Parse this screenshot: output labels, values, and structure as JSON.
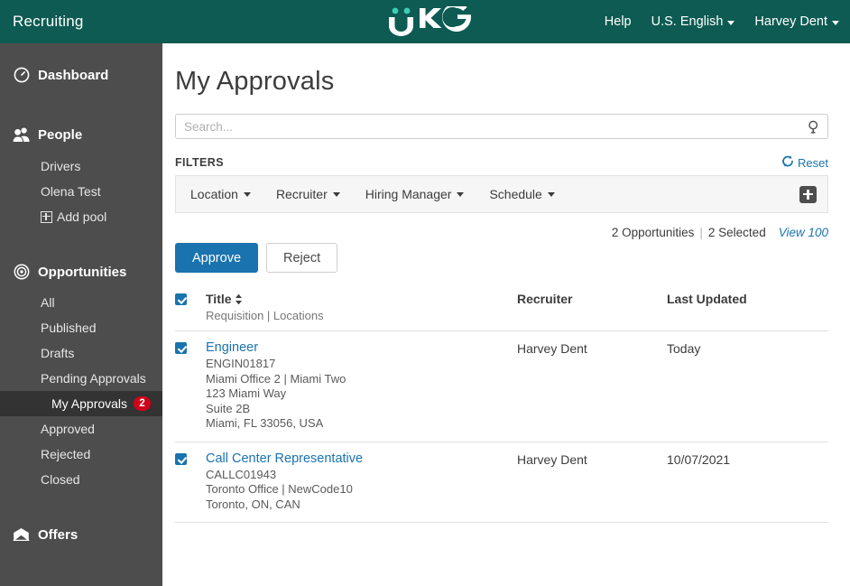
{
  "topbar": {
    "app_title": "Recruiting",
    "logo_text": "UKG",
    "logo_dot_color": "#3ccfb4",
    "nav": [
      {
        "label": "Help",
        "caret": false,
        "name": "help"
      },
      {
        "label": "U.S. English",
        "caret": true,
        "name": "language"
      },
      {
        "label": "Harvey Dent",
        "caret": true,
        "name": "user-menu"
      }
    ],
    "bg_color": "#0d5b53"
  },
  "sidebar": {
    "bg_color": "#4d4d4d",
    "active_bg_color": "#333333",
    "badge_color": "#d0021b",
    "groups": [
      {
        "name": "dashboard",
        "label": "Dashboard",
        "icon": "clock-icon",
        "items": []
      },
      {
        "name": "people",
        "label": "People",
        "icon": "people-icon",
        "items": [
          {
            "label": "Drivers",
            "name": "drivers",
            "active": false,
            "icon": null
          },
          {
            "label": "Olena Test",
            "name": "olena-test",
            "active": false,
            "icon": null
          },
          {
            "label": "Add pool",
            "name": "add-pool",
            "active": false,
            "icon": "square-plus-icon"
          }
        ]
      },
      {
        "name": "opportunities",
        "label": "Opportunities",
        "icon": "target-icon",
        "items": [
          {
            "label": "All",
            "name": "all",
            "active": false,
            "icon": null
          },
          {
            "label": "Published",
            "name": "published",
            "active": false,
            "icon": null
          },
          {
            "label": "Drafts",
            "name": "drafts",
            "active": false,
            "icon": null
          },
          {
            "label": "Pending Approvals",
            "name": "pending-approvals",
            "active": false,
            "icon": null
          },
          {
            "label": "My Approvals",
            "name": "my-approvals",
            "active": true,
            "badge": "2",
            "indent": true,
            "icon": null
          },
          {
            "label": "Approved",
            "name": "approved",
            "active": false,
            "icon": null
          },
          {
            "label": "Rejected",
            "name": "rejected",
            "active": false,
            "icon": null
          },
          {
            "label": "Closed",
            "name": "closed",
            "active": false,
            "icon": null
          }
        ]
      },
      {
        "name": "offers",
        "label": "Offers",
        "icon": "envelope-icon",
        "items": []
      }
    ]
  },
  "main": {
    "page_title": "My Approvals",
    "search": {
      "placeholder": "Search...",
      "value": "",
      "icon": "search-icon"
    },
    "filters": {
      "label": "FILTERS",
      "reset_label": "Reset",
      "reset_icon": "refresh-icon",
      "add_icon": "plus-icon",
      "items": [
        {
          "label": "Location",
          "name": "filter-location"
        },
        {
          "label": "Recruiter",
          "name": "filter-recruiter"
        },
        {
          "label": "Hiring Manager",
          "name": "filter-hiring-manager"
        },
        {
          "label": "Schedule",
          "name": "filter-schedule"
        }
      ]
    },
    "summary": {
      "count_text": "2 Opportunities",
      "separator": "|",
      "selected_text": "2 Selected",
      "view_link": "View 100"
    },
    "actions": {
      "approve_label": "Approve",
      "reject_label": "Reject",
      "primary_color": "#1a73ae"
    },
    "table": {
      "header": {
        "title": "Title",
        "title_sub": "Requisition | Locations",
        "recruiter": "Recruiter",
        "last_updated": "Last Updated",
        "select_all_checked": true
      },
      "rows": [
        {
          "checked": true,
          "title": "Engineer",
          "requisition": "ENGIN01817",
          "location_lines": [
            "Miami Office 2 | Miami Two",
            "123 Miami Way",
            "Suite 2B",
            "Miami, FL 33056, USA"
          ],
          "recruiter": "Harvey Dent",
          "last_updated": "Today"
        },
        {
          "checked": true,
          "title": "Call Center Representative",
          "requisition": "CALLC01943",
          "location_lines": [
            "Toronto Office | NewCode10",
            "Toronto, ON, CAN"
          ],
          "recruiter": "Harvey Dent",
          "last_updated": "10/07/2021"
        }
      ]
    }
  }
}
